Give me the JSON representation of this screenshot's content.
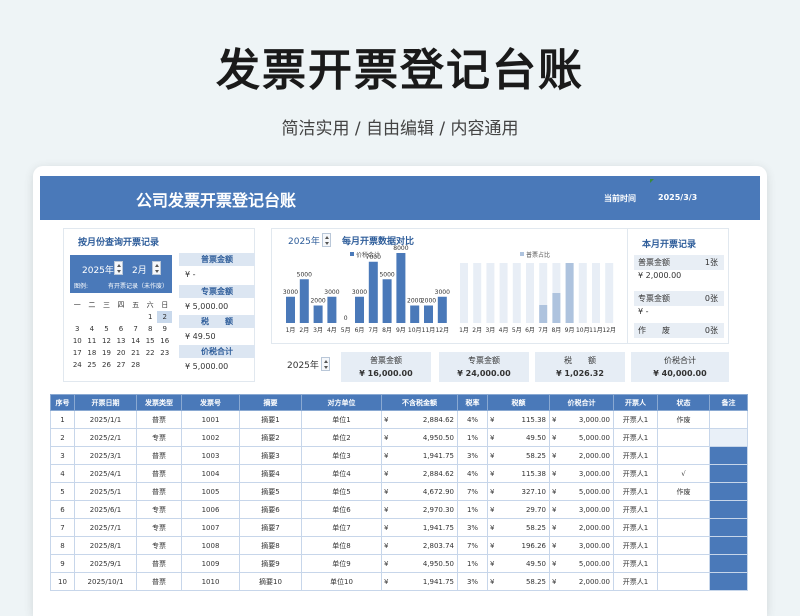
{
  "hero": {
    "title": "发票开票登记台账",
    "subtitle": "简洁实用 / 自由编辑 / 内容通用"
  },
  "banner": {
    "title": "公司发票开票登记台账",
    "date_label": "当前时间",
    "date_value": "2025/3/3"
  },
  "monthly_query": {
    "title": "按月份查询开票记录",
    "year": "2025年",
    "month": "2月",
    "legend": "图例:",
    "legend_text": "有开票记录（未作废）",
    "weekdays": [
      "一",
      "二",
      "三",
      "四",
      "五",
      "六",
      "日"
    ],
    "weeks": [
      [
        "",
        "",
        "",
        "",
        "",
        "1",
        "2"
      ],
      [
        "3",
        "4",
        "5",
        "6",
        "7",
        "8",
        "9"
      ],
      [
        "10",
        "11",
        "12",
        "13",
        "14",
        "15",
        "16"
      ],
      [
        "17",
        "18",
        "19",
        "20",
        "21",
        "22",
        "23"
      ],
      [
        "24",
        "25",
        "26",
        "27",
        "28",
        "",
        ""
      ]
    ],
    "selected_day": "2",
    "summary": [
      {
        "label": "普票金额",
        "value": "¥ -"
      },
      {
        "label": "专票金额",
        "value": "¥ 5,000.00"
      },
      {
        "label": "税　　额",
        "value": "¥ 49.50"
      },
      {
        "label": "价税合计",
        "value": "¥ 5,000.00"
      }
    ]
  },
  "chart_panel": {
    "year": "2025年",
    "title": "每月开票数据对比"
  },
  "chart_data": [
    {
      "type": "bar",
      "categories": [
        "1月",
        "2月",
        "3月",
        "4月",
        "5月",
        "6月",
        "7月",
        "8月",
        "9月",
        "10月",
        "11月",
        "12月"
      ],
      "series": [
        {
          "name": "价税合计",
          "values": [
            3000,
            5000,
            2000,
            3000,
            0,
            3000,
            7000,
            5000,
            8000,
            2000,
            2000,
            3000
          ]
        }
      ],
      "data_labels": [
        "3000",
        "5000",
        "2000",
        "3000",
        "0",
        "3000",
        "7000",
        "5000",
        "8000",
        "2000",
        "2000",
        "3000"
      ],
      "color": "#4a79b9"
    },
    {
      "type": "bar",
      "categories": [
        "1月",
        "2月",
        "3月",
        "4月",
        "5月",
        "6月",
        "7月",
        "8月",
        "9月",
        "10月",
        "11月",
        "12月"
      ],
      "series": [
        {
          "name": "普票占比",
          "values": [
            1,
            1,
            1,
            1,
            1,
            1,
            0.3,
            0.5,
            1,
            1,
            1,
            1
          ]
        }
      ],
      "background_values": [
        1,
        1,
        1,
        1,
        1,
        1,
        1,
        1,
        1,
        1,
        1,
        1
      ],
      "color": "#aec3de",
      "background_color": "#e8eef6"
    }
  ],
  "year_summary": {
    "year": "2025年",
    "cards": [
      {
        "label": "普票金额",
        "value": "¥ 16,000.00"
      },
      {
        "label": "专票金额",
        "value": "¥ 24,000.00"
      },
      {
        "label": "税　　额",
        "value": "¥ 1,026.32"
      },
      {
        "label": "价税合计",
        "value": "¥ 40,000.00"
      }
    ]
  },
  "this_month": {
    "title": "本月开票记录",
    "rows": [
      {
        "label": "普票金额",
        "count": "1张",
        "value": "¥ 2,000.00"
      },
      {
        "label": "专票金额",
        "count": "0张",
        "value": "¥ -"
      },
      {
        "label": "作　　废",
        "count": "0张",
        "value": ""
      }
    ]
  },
  "table": {
    "headers": [
      "序号",
      "开票日期",
      "发票类型",
      "发票号",
      "摘要",
      "对方单位",
      "不含税金额",
      "税率",
      "税额",
      "价税合计",
      "开票人",
      "状态",
      "备注"
    ],
    "rows": [
      [
        "1",
        "2025/1/1",
        "普票",
        "1001",
        "摘要1",
        "单位1",
        "2,884.62",
        "4%",
        "115.38",
        "3,000.00",
        "开票人1",
        "作废",
        ""
      ],
      [
        "2",
        "2025/2/1",
        "专票",
        "1002",
        "摘要2",
        "单位2",
        "4,950.50",
        "1%",
        "49.50",
        "5,000.00",
        "开票人1",
        "",
        ""
      ],
      [
        "3",
        "2025/3/1",
        "普票",
        "1003",
        "摘要3",
        "单位3",
        "1,941.75",
        "3%",
        "58.25",
        "2,000.00",
        "开票人1",
        "",
        ""
      ],
      [
        "4",
        "2025/4/1",
        "普票",
        "1004",
        "摘要4",
        "单位4",
        "2,884.62",
        "4%",
        "115.38",
        "3,000.00",
        "开票人1",
        "√",
        ""
      ],
      [
        "5",
        "2025/5/1",
        "普票",
        "1005",
        "摘要5",
        "单位5",
        "4,672.90",
        "7%",
        "327.10",
        "5,000.00",
        "开票人1",
        "作废",
        ""
      ],
      [
        "6",
        "2025/6/1",
        "专票",
        "1006",
        "摘要6",
        "单位6",
        "2,970.30",
        "1%",
        "29.70",
        "3,000.00",
        "开票人1",
        "",
        ""
      ],
      [
        "7",
        "2025/7/1",
        "专票",
        "1007",
        "摘要7",
        "单位7",
        "1,941.75",
        "3%",
        "58.25",
        "2,000.00",
        "开票人1",
        "",
        ""
      ],
      [
        "8",
        "2025/8/1",
        "专票",
        "1008",
        "摘要8",
        "单位8",
        "2,803.74",
        "7%",
        "196.26",
        "3,000.00",
        "开票人1",
        "",
        ""
      ],
      [
        "9",
        "2025/9/1",
        "普票",
        "1009",
        "摘要9",
        "单位9",
        "4,950.50",
        "1%",
        "49.50",
        "5,000.00",
        "开票人1",
        "",
        ""
      ],
      [
        "10",
        "2025/10/1",
        "普票",
        "1010",
        "摘要10",
        "单位10",
        "1,941.75",
        "3%",
        "58.25",
        "2,000.00",
        "开票人1",
        "",
        ""
      ]
    ],
    "currency": "¥"
  }
}
